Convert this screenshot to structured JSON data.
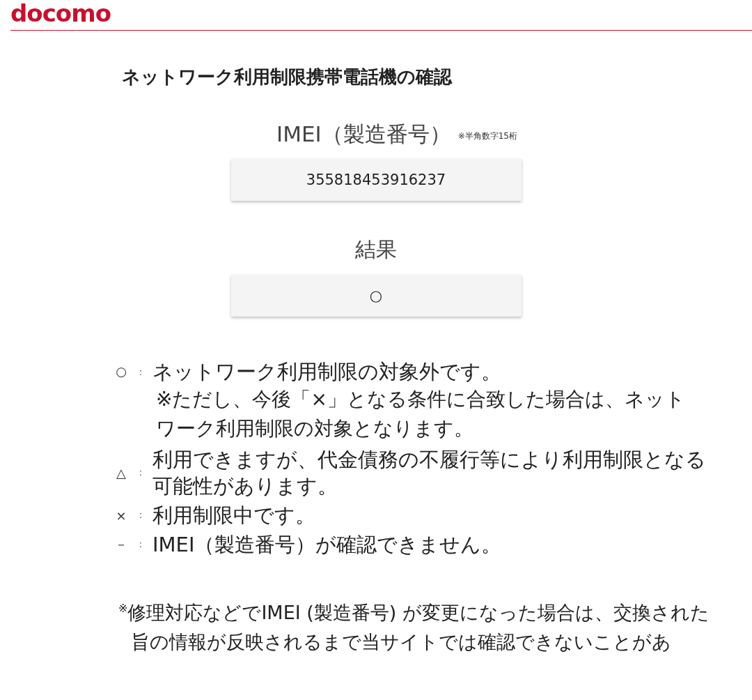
{
  "header": {
    "logo": "docomo"
  },
  "title": "ネットワーク利用制限携帯電話機の確認",
  "imei": {
    "label": "IMEI（製造番号）",
    "note": "※半角数字15桁",
    "value": "355818453916237"
  },
  "result": {
    "label": "結果",
    "value": "○"
  },
  "legend": [
    {
      "symbol": "○",
      "separator": "：",
      "text": "ネットワーク利用制限の対象外です。",
      "note": "※ただし、今後「×」となる条件に合致した場合は、ネットワーク利用制限の対象となります。"
    },
    {
      "symbol": "△",
      "separator": "：",
      "text": "利用できますが、代金債務の不履行等により利用制限となる可能性があります。"
    },
    {
      "symbol": "×",
      "separator": "：",
      "text": "利用制限中です。"
    },
    {
      "symbol": "－",
      "separator": "：",
      "text": "IMEI（製造番号）が確認できません。"
    }
  ],
  "footnote": "$^{※}$修理対応などでIMEI (製造番号) が変更になった場合は、交換された旨の情報が反映されるまで当サイトでは確認できないことがあ"
}
